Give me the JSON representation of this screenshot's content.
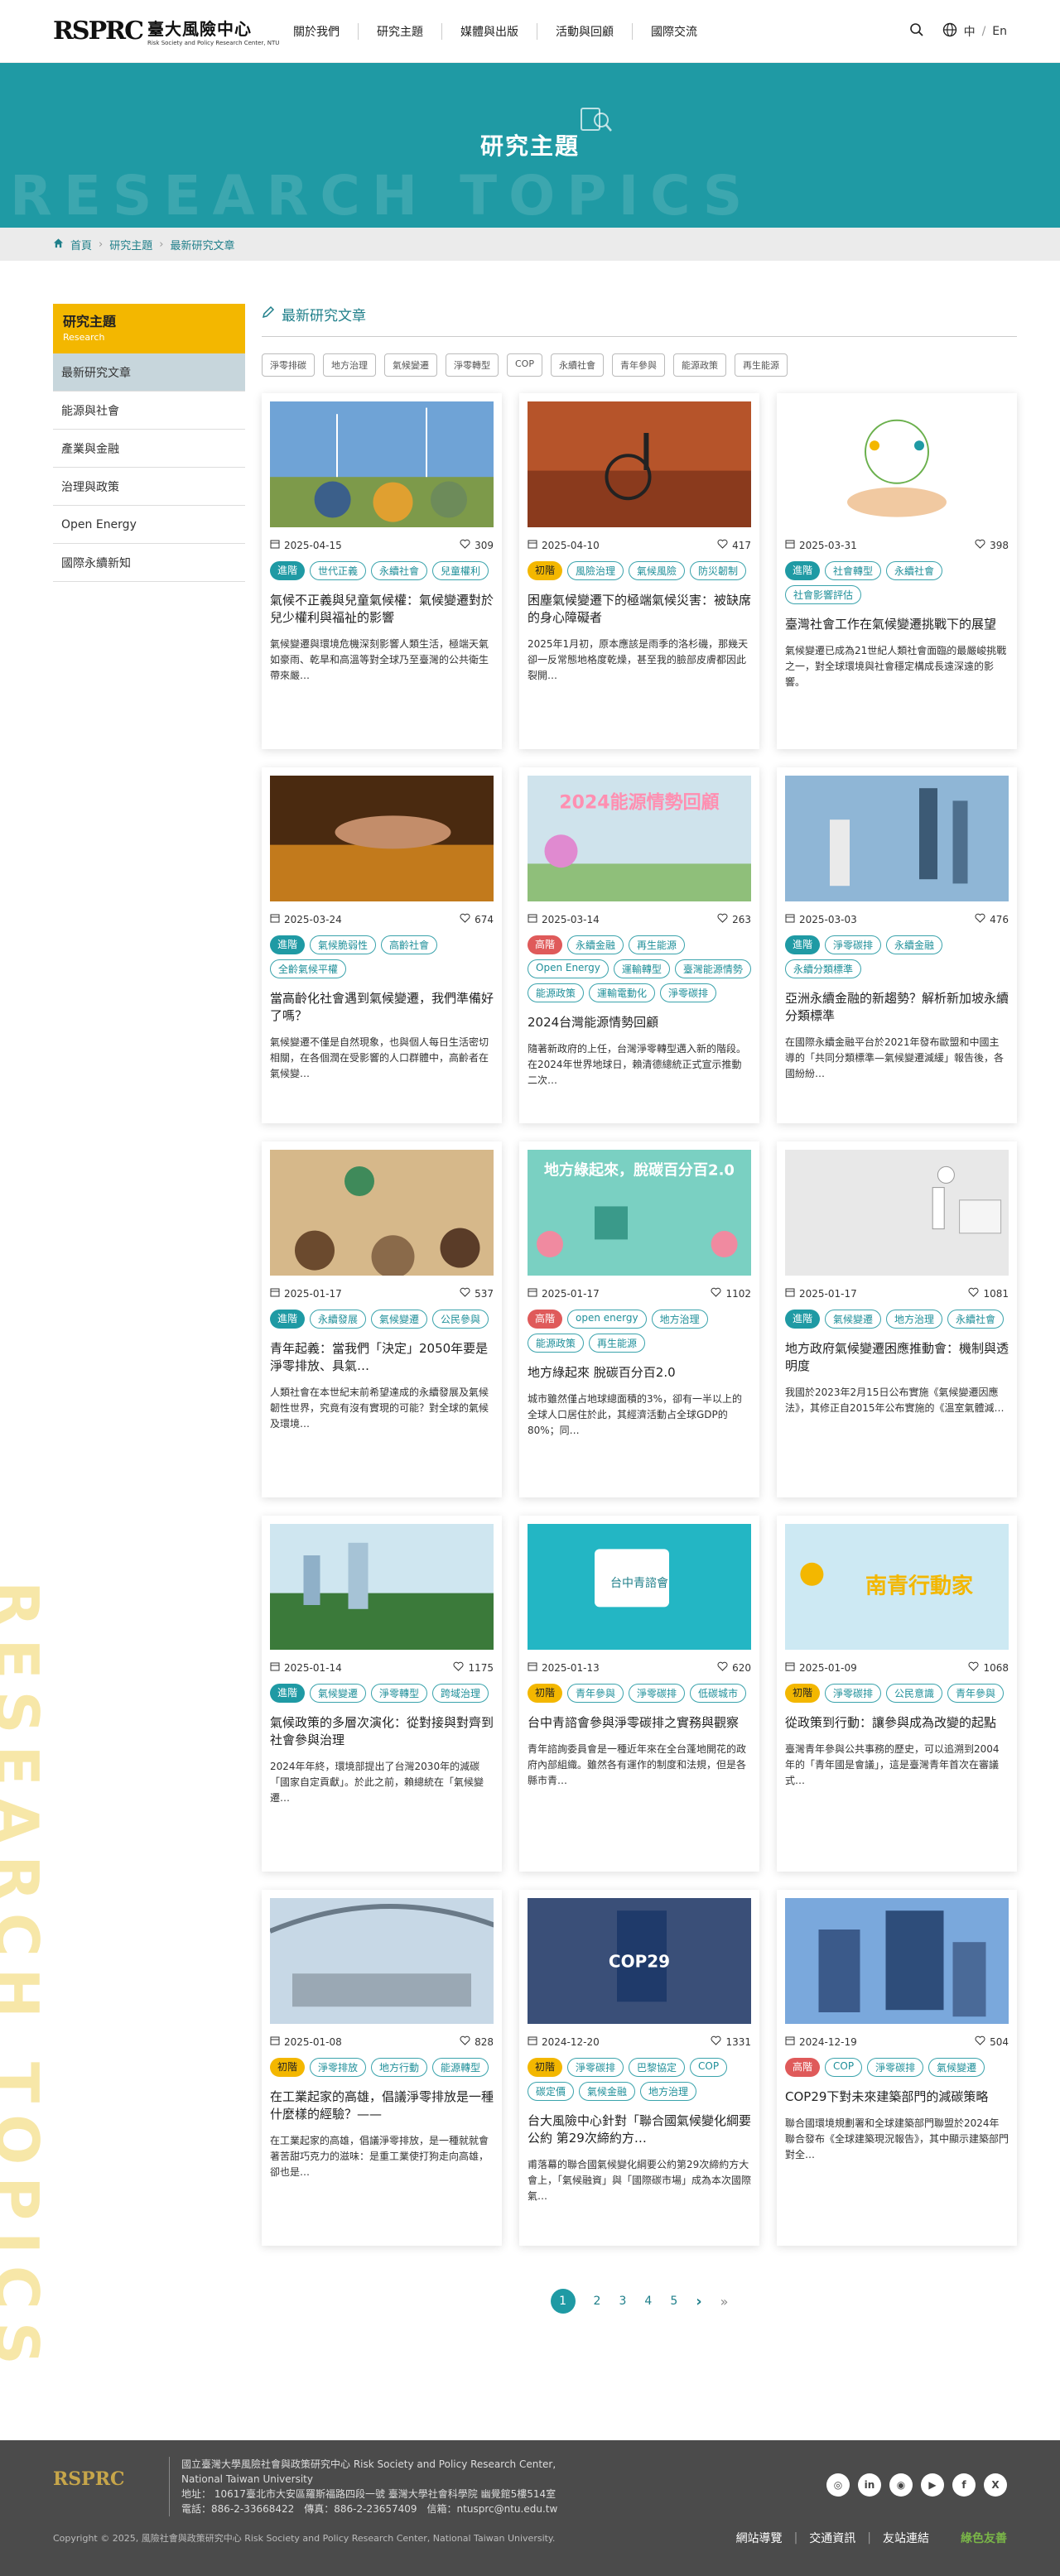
{
  "header": {
    "logo_mark": "RSPRC",
    "logo_zh": "臺大風險中心",
    "logo_en": "Risk Society and Policy Research Center, NTU",
    "nav": [
      "關於我們",
      "研究主題",
      "媒體與出版",
      "活動與回顧",
      "國際交流"
    ],
    "lang_zh": "中",
    "lang_sep": "/",
    "lang_en": "En"
  },
  "banner": {
    "title": "研究主題",
    "ghost": "RESEARCH TOPICS"
  },
  "breadcrumb": [
    "首頁",
    "研究主題",
    "最新研究文章"
  ],
  "side_ghost": "RESEARCH TOPICS",
  "sidebar": {
    "head_zh": "研究主題",
    "head_en": "Research",
    "items": [
      "最新研究文章",
      "能源與社會",
      "產業與金融",
      "治理與政策",
      "Open Energy",
      "國際永續新知"
    ]
  },
  "main": {
    "section_title": "最新研究文章",
    "tags": [
      "淨零排碳",
      "地方治理",
      "氣候變遷",
      "淨零轉型",
      "COP",
      "永續社會",
      "青年參與",
      "能源政策",
      "再生能源"
    ]
  },
  "cards": [
    {
      "date": "2025-04-15",
      "likes": "309",
      "level": "進階",
      "lv": "a",
      "chips": [
        "世代正義",
        "永續社會",
        "兒童權利"
      ],
      "title": "氣候不正義與兒童氣候權：氣候變遷對於兒少權利與福祉的影響",
      "desc": "氣候變遷與環境危機深刻影響人類生活，極端天氣如豪雨、乾旱和高溫等對全球乃至臺灣的公共衛生帶來嚴…",
      "img": "img1"
    },
    {
      "date": "2025-04-10",
      "likes": "417",
      "level": "初階",
      "lv": "b",
      "chips": [
        "風險治理",
        "氣候風險",
        "防災韌制"
      ],
      "title": "困塵氣候變遷下的極端氣候災害：被缺席的身心障礙者",
      "desc": "2025年1月初，原本應該是雨季的洛杉磯，那幾天卻一反常態地格度乾燥，甚至我的臉部皮膚都因此裂開…",
      "img": "img2"
    },
    {
      "date": "2025-03-31",
      "likes": "398",
      "level": "進階",
      "lv": "a",
      "chips": [
        "社會轉型",
        "永續社會",
        "社會影響評估"
      ],
      "title": "臺灣社會工作在氣候變遷挑戰下的展望",
      "desc": "氣候變遷已成為21世紀人類社會面臨的最嚴峻挑戰之一，對全球環境與社會穩定構成長遠深遠的影響。",
      "img": "img3"
    },
    {
      "date": "2025-03-24",
      "likes": "674",
      "level": "進階",
      "lv": "a",
      "chips": [
        "氣候脆弱性",
        "高齡社會",
        "全齡氣候平權"
      ],
      "title": "當高齡化社會遇到氣候變遷，我們準備好了嗎？",
      "desc": "氣候變遷不僅是自然現象，也與個人每日生活密切相關，在各個潤在受影響的人口群體中，高齡者在氣候變…",
      "img": "img4"
    },
    {
      "date": "2025-03-14",
      "likes": "263",
      "level": "高階",
      "lv": "c",
      "chips": [
        "永續金融",
        "再生能源",
        "Open Energy",
        "運輸轉型",
        "臺灣能源情勢",
        "能源政策",
        "運輸電動化",
        "淨零碳排"
      ],
      "title": "2024台灣能源情勢回顧",
      "desc": "隨著新政府的上任，台灣淨零轉型邁入新的階段。在2024年世界地球日，賴清德總統正式宣示推動二次…",
      "img": "img5"
    },
    {
      "date": "2025-03-03",
      "likes": "476",
      "level": "進階",
      "lv": "a",
      "chips": [
        "淨零碳排",
        "永續金融",
        "永續分類標準"
      ],
      "title": "亞洲永續金融的新趨勢？解析新加坡永續分類標準",
      "desc": "在國際永續金融平台於2021年發布歐盟和中國主導的「共同分類標準—氣候變遷減緩」報告後，各國紛紛…",
      "img": "img6"
    },
    {
      "date": "2025-01-17",
      "likes": "537",
      "level": "進階",
      "lv": "a",
      "chips": [
        "永續發展",
        "氣候變遷",
        "公民參與"
      ],
      "title": "青年起義：當我們「決定」2050年要是淨零排放、具氣…",
      "desc": "人類社會在本世紀末前希望達成的永續發展及氣候韌性世界，究竟有沒有實現的可能？對全球的氣候及環境…",
      "img": "img7"
    },
    {
      "date": "2025-01-17",
      "likes": "1102",
      "level": "高階",
      "lv": "c",
      "chips": [
        "open energy",
        "地方治理",
        "能源政策",
        "再生能源"
      ],
      "title": "地方綠起來 脫碳百分百2.0",
      "desc": "城市雖然僅占地球總面積的3%，卻有一半以上的全球人口居住於此，其經濟活動占全球GDP的80%；同…",
      "img": "img8"
    },
    {
      "date": "2025-01-17",
      "likes": "1081",
      "level": "進階",
      "lv": "a",
      "chips": [
        "氣候變遷",
        "地方治理",
        "永續社會"
      ],
      "title": "地方政府氣候變遷困應推動會：機制與透明度",
      "desc": "我國於2023年2月15日公布實施《氣候變遷因應法》，其修正自2015年公布實施的《溫室氣體減…",
      "img": "img9"
    },
    {
      "date": "2025-01-14",
      "likes": "1175",
      "level": "進階",
      "lv": "a",
      "chips": [
        "氣候變遷",
        "淨零轉型",
        "跨域治理"
      ],
      "title": "氣候政策的多層次演化：從對接與對齊到社會參與治理",
      "desc": "2024年年終，環境部提出了台灣2030年的減碳「國家自定貢獻」。於此之前，賴總統在「氣候變遷…",
      "img": "img10"
    },
    {
      "date": "2025-01-13",
      "likes": "620",
      "level": "初階",
      "lv": "b",
      "chips": [
        "青年參與",
        "淨零碳排",
        "低碳城市"
      ],
      "title": "台中青諮會參與淨零碳排之實務與觀察",
      "desc": "青年諮詢委員會是一種近年來在全台蓬地開花的政府內部組織。雖然各有運作的制度和法規，但是各縣市青…",
      "img": "img11"
    },
    {
      "date": "2025-01-09",
      "likes": "1068",
      "level": "初階",
      "lv": "b",
      "chips": [
        "淨零碳排",
        "公民意識",
        "青年參與"
      ],
      "title": "從政策到行動：讓參與成為改變的起點",
      "desc": "臺灣青年參與公共事務的歷史，可以追溯到2004年的「青年國是會議」，這是臺灣青年首次在審議式…",
      "img": "img12"
    },
    {
      "date": "2025-01-08",
      "likes": "828",
      "level": "初階",
      "lv": "b",
      "chips": [
        "淨零排放",
        "地方行動",
        "能源轉型"
      ],
      "title": "在工業起家的高雄，倡議淨零排放是一種什麼樣的經驗？——",
      "desc": "在工業起家的高雄，倡議淨零排放，是一種就就會著苦甜巧克力的滋味：是重工業使打狗走向高雄，卻也是…",
      "img": "img13"
    },
    {
      "date": "2024-12-20",
      "likes": "1331",
      "level": "初階",
      "lv": "b",
      "chips": [
        "淨零碳排",
        "巴黎協定",
        "COP",
        "碳定價",
        "氣候金融",
        "地方治理"
      ],
      "title": "台大風險中心針對「聯合國氣候變化綱要公約 第29次締約方…",
      "desc": "甫落幕的聯合國氣候變化綱要公約第29次締約方大會上，「氣候融資」與「國際碳市場」成為本次國際氣…",
      "img": "img14"
    },
    {
      "date": "2024-12-19",
      "likes": "504",
      "level": "高階",
      "lv": "c",
      "chips": [
        "COP",
        "淨零碳排",
        "氣候變遷"
      ],
      "title": "COP29下對未來建築部門的減碳策略",
      "desc": "聯合國環境規劃署和全球建築部門聯盟於2024年聯合發布《全球建築現況報告》，其中顯示建築部門對全…",
      "img": "img15"
    }
  ],
  "pager": {
    "pages": [
      "1",
      "2",
      "3",
      "4",
      "5"
    ],
    "next": "›",
    "last": "»"
  },
  "footer": {
    "logo_mark": "RSPRC",
    "info": [
      "國立臺灣大學風險社會與政策研究中心 Risk Society and Policy Research Center,",
      "National Taiwan University",
      "地址： 10617臺北市大安區羅斯福路四段一號 臺灣大學社會科學院 幽覺館5樓514室",
      "電話：886-2-33668422　傳真：886-2-23657409　信箱：ntusprc@ntu.edu.tw"
    ],
    "social": [
      "◎",
      "in",
      "◉",
      "▶",
      "f",
      "X"
    ],
    "copyright": "Copyright © 2025, 風險社會與政策研究中心 Risk Society and Policy Research Center, National Taiwan University.",
    "links": [
      "網站導覽",
      "交通資訊",
      "友站連結"
    ],
    "badge": "綠色友善"
  },
  "colors": {
    "teal": "#1f9aa4",
    "yellow": "#f3b700",
    "red": "#df5a5a",
    "footer": "#4b4b4b"
  }
}
